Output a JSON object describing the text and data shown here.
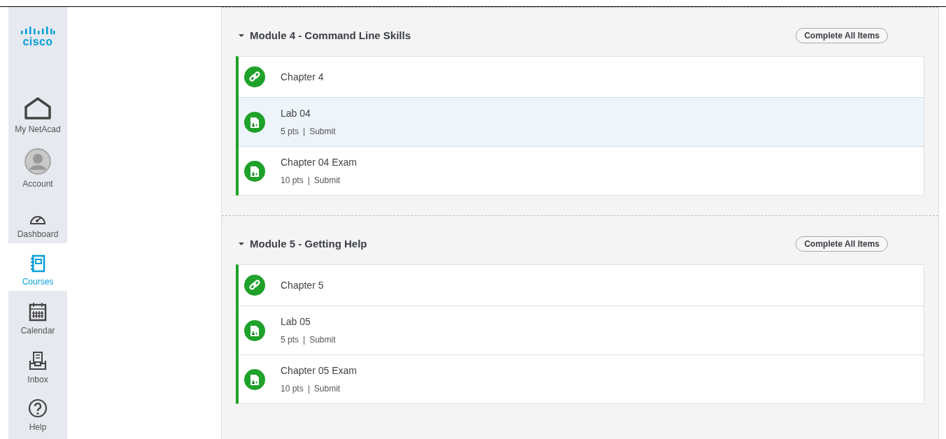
{
  "logo": {
    "text": "cisco"
  },
  "sidebar": {
    "items": [
      {
        "label": "My NetAcad",
        "kind": "home",
        "selected": false
      },
      {
        "label": "Account",
        "kind": "account",
        "selected": false
      },
      {
        "label": "Dashboard",
        "kind": "dashboard",
        "selected": false
      },
      {
        "label": "Courses",
        "kind": "courses",
        "selected": true
      },
      {
        "label": "Calendar",
        "kind": "calendar",
        "selected": false
      },
      {
        "label": "Inbox",
        "kind": "inbox",
        "selected": false
      },
      {
        "label": "Help",
        "kind": "help",
        "selected": false
      }
    ]
  },
  "modules": [
    {
      "title": "Module 4 - Command Line Skills",
      "expanded": true,
      "button": "Complete All Items",
      "items": [
        {
          "kind": "link",
          "title": "Chapter 4",
          "selected": false
        },
        {
          "kind": "assignment",
          "title": "Lab 04",
          "points": "5 pts",
          "separator": "|",
          "action": "Submit",
          "selected": true
        },
        {
          "kind": "assignment",
          "title": "Chapter 04 Exam",
          "points": "10 pts",
          "separator": "|",
          "action": "Submit",
          "selected": false
        }
      ]
    },
    {
      "title": "Module 5 - Getting Help",
      "expanded": true,
      "button": "Complete All Items",
      "items": [
        {
          "kind": "link",
          "title": "Chapter 5",
          "selected": false
        },
        {
          "kind": "assignment",
          "title": "Lab 05",
          "points": "5 pts",
          "separator": "|",
          "action": "Submit",
          "selected": false
        },
        {
          "kind": "assignment",
          "title": "Chapter 05 Exam",
          "points": "10 pts",
          "separator": "|",
          "action": "Submit",
          "selected": false
        }
      ]
    }
  ]
}
